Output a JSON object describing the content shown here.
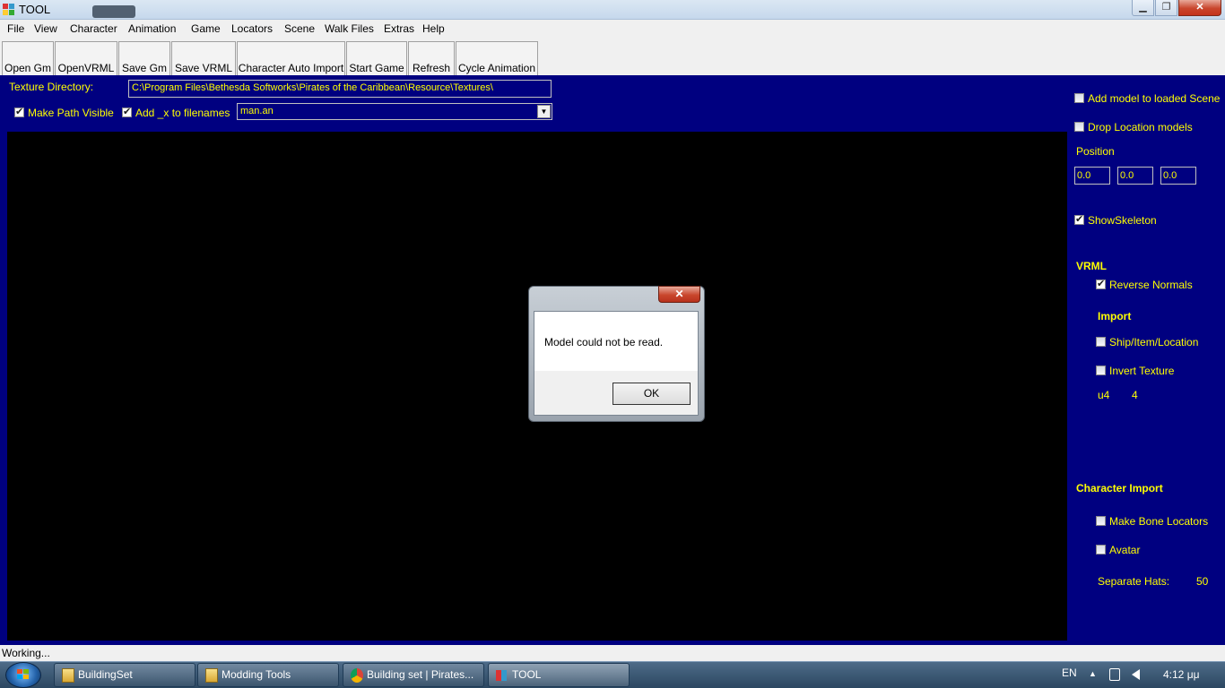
{
  "window": {
    "title": "TOOL",
    "min": "▁",
    "max": "❐",
    "close": "✕"
  },
  "menu": [
    "File",
    "View",
    "Character",
    "Animation",
    "Game",
    "Locators",
    "Scene",
    "Walk Files",
    "Extras",
    "Help"
  ],
  "toolbar": [
    "Open Gm",
    "OpenVRML",
    "Save Gm",
    "Save VRML",
    "Character Auto Import",
    "Start Game",
    "Refresh",
    "Cycle Animation"
  ],
  "texture": {
    "label": "Texture Directory:",
    "path": "C:\\Program Files\\Bethesda Softworks\\Pirates of the Caribbean\\Resource\\Textures\\",
    "make_path_visible": "Make Path Visible",
    "add_x": "Add _x to filenames",
    "animation_file": "man.an",
    "combo_arrow": "▼"
  },
  "right_panel": {
    "add_model": "Add model to loaded Scene",
    "drop_location": "Drop Location models",
    "position_label": "Position",
    "position": [
      "0.0",
      "0.0",
      "0.0"
    ],
    "show_skeleton": "ShowSkeleton",
    "vrml_header": "VRML",
    "reverse_normals": "Reverse Normals",
    "import_header": "Import",
    "ship_item_location": "Ship/Item/Location",
    "invert_texture": "Invert Texture",
    "u_label": "u4",
    "u_value": "4",
    "char_import_header": "Character Import",
    "make_bone_locators": "Make Bone Locators",
    "avatar": "Avatar",
    "separate_hats_label": "Separate Hats:",
    "separate_hats_value": "50"
  },
  "dialog": {
    "close": "✕",
    "message": "Model could not be read.",
    "ok": "OK"
  },
  "status": "Working...",
  "taskbar": {
    "items": [
      "BuildingSet",
      "Modding Tools",
      "Building set | Pirates...",
      "TOOL"
    ],
    "lang": "EN",
    "up_arrow": "▲",
    "clock": "4:12 μμ"
  },
  "colors": {
    "panel": "#000080",
    "label": "#ffff00",
    "viewport": "#000000"
  }
}
